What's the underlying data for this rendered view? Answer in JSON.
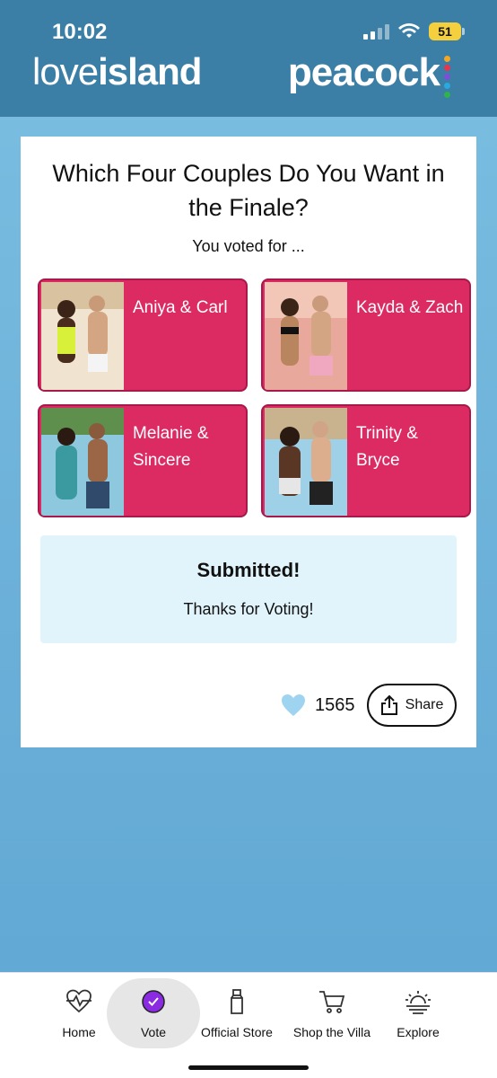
{
  "status_bar": {
    "time": "10:02",
    "battery": "51"
  },
  "header": {
    "left_logo_light": "love",
    "left_logo_bold": "island",
    "right_logo": "peacock"
  },
  "poll": {
    "question": "Which Four Couples Do You Want in the Finale?",
    "subtitle": "You voted for ...",
    "couples": [
      {
        "name": "Aniya & Carl"
      },
      {
        "name": "Kayda & Zach"
      },
      {
        "name": "Melanie & Sincere"
      },
      {
        "name": "Trinity & Bryce"
      }
    ],
    "submitted_title": "Submitted!",
    "submitted_message": "Thanks for Voting!",
    "likes": "1565",
    "share_label": "Share"
  },
  "tabs": [
    {
      "label": "Home",
      "icon": "heartbeat-icon"
    },
    {
      "label": "Vote",
      "icon": "check-circle-icon",
      "active": true
    },
    {
      "label": "Official Store",
      "icon": "bottle-icon"
    },
    {
      "label": "Shop the Villa",
      "icon": "cart-icon"
    },
    {
      "label": "Explore",
      "icon": "sunset-icon"
    }
  ],
  "colors": {
    "header_bg": "#3b7fa6",
    "page_bg": "#6aafd8",
    "couple_card": "#db2b62",
    "submitted_bg": "#e1f4fc",
    "heart": "#9fd4f0",
    "vote_accent": "#8a2be2"
  }
}
